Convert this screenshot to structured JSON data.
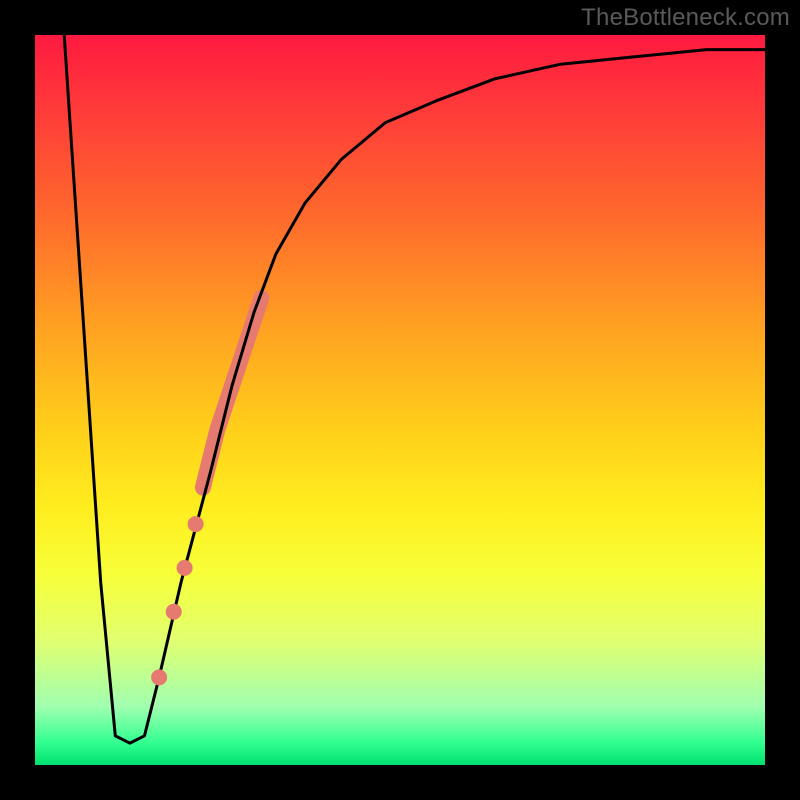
{
  "watermark": "TheBottleneck.com",
  "chart_data": {
    "type": "line",
    "title": "",
    "xlabel": "",
    "ylabel": "",
    "xlim": [
      0,
      100
    ],
    "ylim": [
      0,
      100
    ],
    "legend": false,
    "grid": false,
    "series": [
      {
        "name": "bottleneck-curve",
        "color": "#000000",
        "x": [
          4,
          9,
          11,
          13,
          15,
          17,
          20,
          24,
          27,
          30,
          33,
          37,
          42,
          48,
          55,
          63,
          72,
          82,
          92,
          100
        ],
        "values": [
          100,
          25,
          4,
          3,
          4,
          12,
          25,
          40,
          52,
          62,
          70,
          77,
          83,
          88,
          91,
          94,
          96,
          97,
          98,
          98
        ]
      }
    ],
    "markers": [
      {
        "x": 17.0,
        "y": 12,
        "r": 5,
        "color": "#e77a70"
      },
      {
        "x": 19.0,
        "y": 21,
        "r": 5,
        "color": "#e77a70"
      },
      {
        "x": 20.5,
        "y": 27,
        "r": 5,
        "color": "#e77a70"
      },
      {
        "x": 22.0,
        "y": 33,
        "r": 5,
        "color": "#e77a70"
      }
    ],
    "thick_segment": {
      "color": "#e77a70",
      "x": [
        23,
        25,
        27,
        29,
        31
      ],
      "values": [
        38,
        46,
        52,
        58,
        64
      ]
    },
    "background": {
      "type": "vertical-gradient",
      "stops": [
        {
          "pos": 0.0,
          "color": "#ff1a40"
        },
        {
          "pos": 0.55,
          "color": "#ffd21a"
        },
        {
          "pos": 0.83,
          "color": "#e0ff70"
        },
        {
          "pos": 1.0,
          "color": "#00e070"
        }
      ]
    }
  }
}
